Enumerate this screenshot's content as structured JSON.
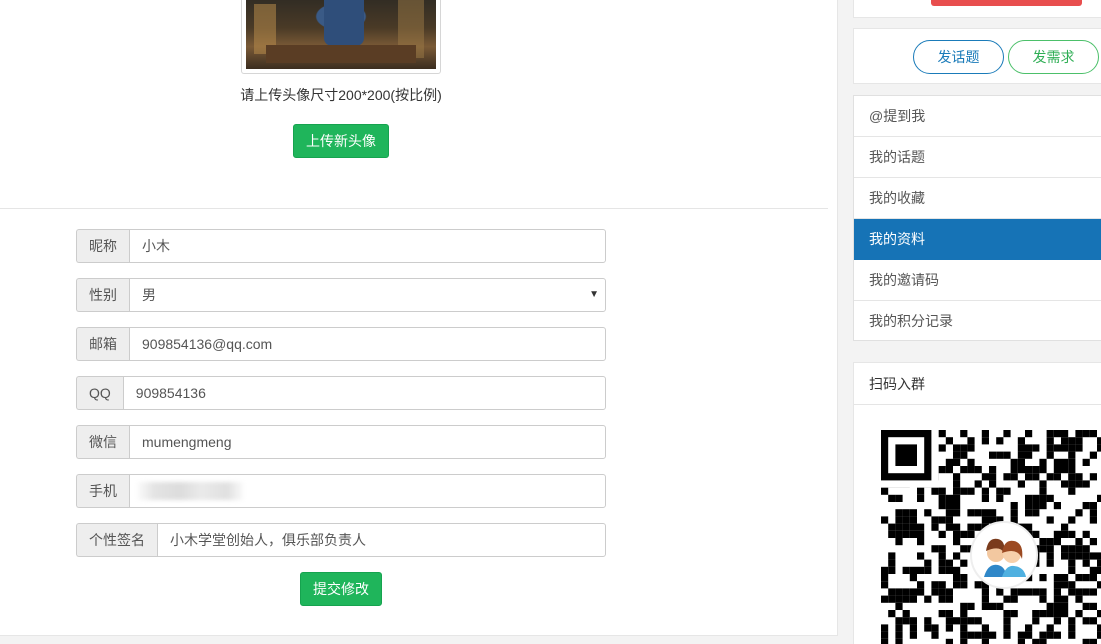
{
  "avatar": {
    "hint": "请上传头像尺寸200*200(按比例)",
    "upload_label": "上传新头像"
  },
  "form": {
    "fields": [
      {
        "label": "昵称",
        "value": "小木"
      },
      {
        "label": "性别",
        "value": "男"
      },
      {
        "label": "邮箱",
        "value": "909854136@qq.com"
      },
      {
        "label": "QQ",
        "value": "909854136"
      },
      {
        "label": "微信",
        "value": "mumengmeng"
      },
      {
        "label": "手机",
        "value": ""
      },
      {
        "label": "个性签名",
        "value": "小木学堂创始人，俱乐部负责人"
      }
    ],
    "submit_label": "提交修改"
  },
  "sidebar": {
    "post_topic": "发话题",
    "post_demand": "发需求",
    "menu": [
      {
        "label": "@提到我"
      },
      {
        "label": "我的话题"
      },
      {
        "label": "我的收藏"
      },
      {
        "label": "我的资料"
      },
      {
        "label": "我的邀请码"
      },
      {
        "label": "我的积分记录"
      }
    ],
    "active_menu": "我的资料",
    "qr_title": "扫码入群"
  },
  "colors": {
    "green": "#1fb55b",
    "active_blue": "#1673b6",
    "red": "#e84e4e"
  }
}
